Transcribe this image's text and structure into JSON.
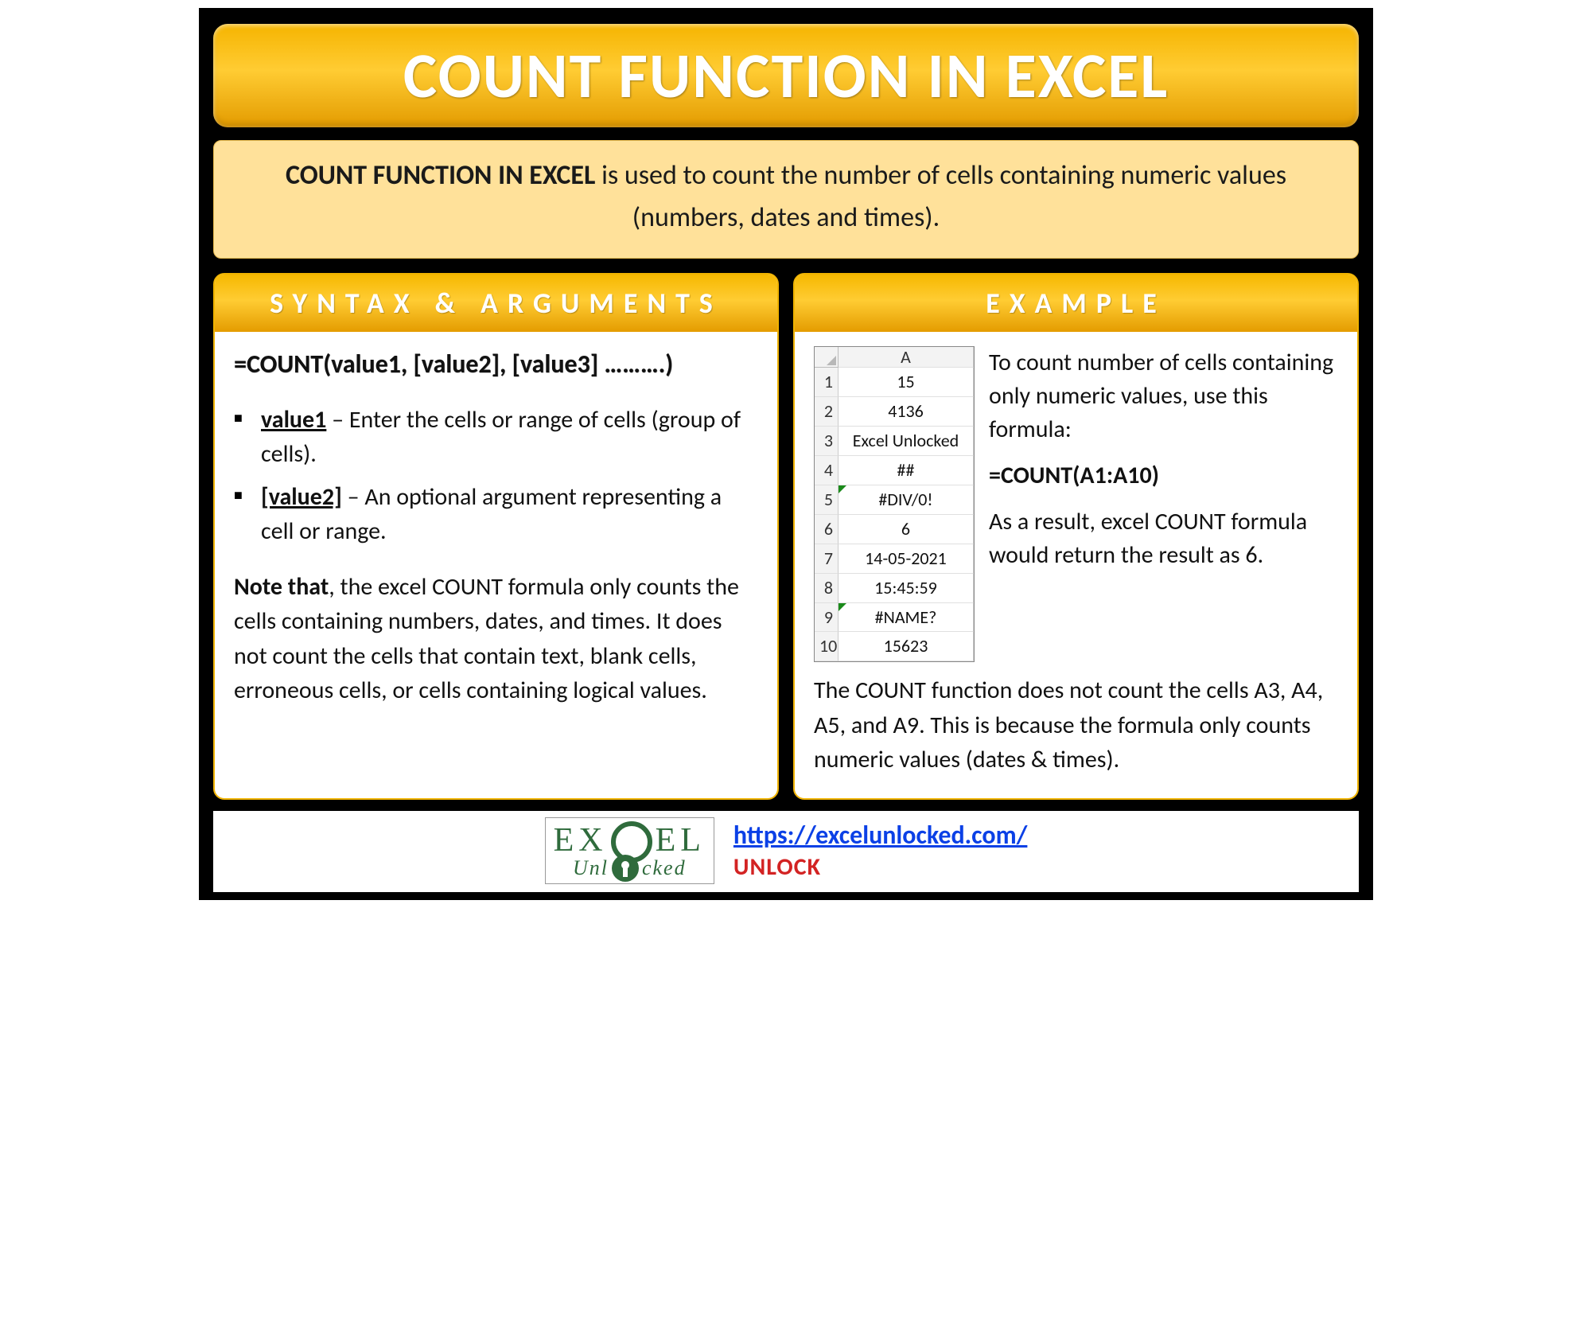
{
  "title": "COUNT FUNCTION IN EXCEL",
  "intro": {
    "bold": "COUNT FUNCTION IN EXCEL",
    "rest": " is used to count the number of cells containing numeric values (numbers, dates and times)."
  },
  "syntax": {
    "header": "SYNTAX & ARGUMENTS",
    "formula": "=COUNT(value1, [value2], [value3] ……….)",
    "args": [
      {
        "name": "value1",
        "desc": " – Enter the cells or range of cells (group of cells)."
      },
      {
        "name": "[value2]",
        "desc": " – An optional argument representing a cell or range."
      }
    ],
    "note_label": "Note that",
    "note_rest": ", the excel COUNT formula only counts the cells containing numbers, dates, and times. It does not count the cells that contain text, blank cells, erroneous cells, or cells containing logical values."
  },
  "example": {
    "header": "EXAMPLE",
    "col_label": "A",
    "rows": [
      {
        "n": "1",
        "v": "15",
        "tri": false
      },
      {
        "n": "2",
        "v": "4136",
        "tri": false
      },
      {
        "n": "3",
        "v": "Excel Unlocked",
        "tri": false
      },
      {
        "n": "4",
        "v": "##",
        "tri": false
      },
      {
        "n": "5",
        "v": "#DIV/0!",
        "tri": true
      },
      {
        "n": "6",
        "v": "6",
        "tri": false
      },
      {
        "n": "7",
        "v": "14-05-2021",
        "tri": false
      },
      {
        "n": "8",
        "v": "15:45:59",
        "tri": false
      },
      {
        "n": "9",
        "v": "#NAME?",
        "tri": true
      },
      {
        "n": "10",
        "v": "15623",
        "tri": false
      }
    ],
    "text1": "To count number of cells containing only numeric values, use this formula:",
    "formula": "=COUNT(A1:A10)",
    "text2": "As a result, excel COUNT formula would return the result as 6.",
    "text3": "The COUNT function does not count the cells A3, A4, A5, and A9. This is because the formula only counts numeric values (dates & times)."
  },
  "footer": {
    "logo_top": "EX EL",
    "logo_left": "Unl",
    "logo_right": "cked",
    "url": "https://excelunlocked.com/",
    "unlock": "UNLOCK"
  }
}
